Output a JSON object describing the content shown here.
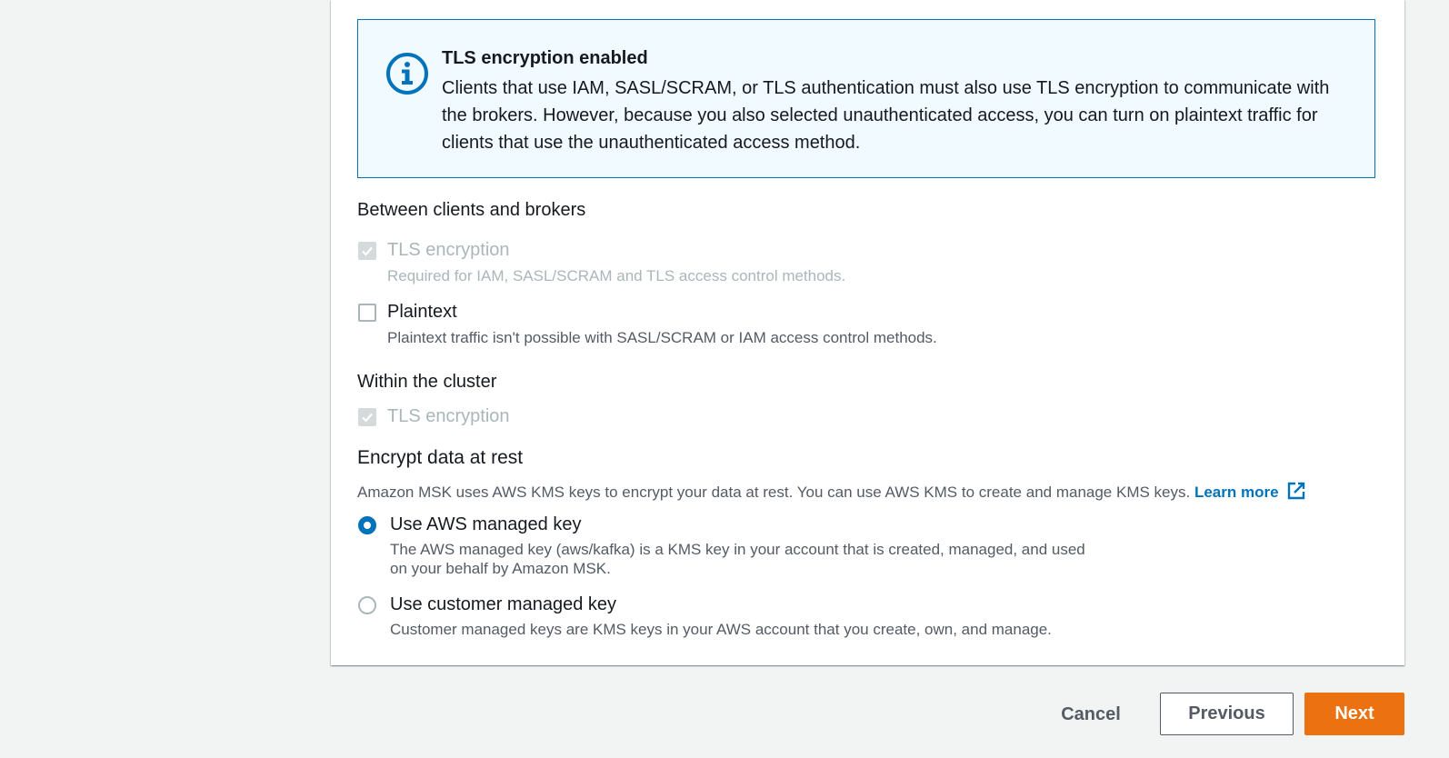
{
  "alert": {
    "title": "TLS encryption enabled",
    "text": "Clients that use IAM, SASL/SCRAM, or TLS authentication must also use TLS encryption to communicate with the brokers. However, because you also selected unauthenticated access, you can turn on plaintext traffic for clients that use the unauthenticated access method.",
    "icon": "info-icon"
  },
  "clients_brokers": {
    "heading": "Between clients and brokers",
    "tls": {
      "label": "TLS encryption",
      "desc": "Required for IAM, SASL/SCRAM and TLS access control methods.",
      "checked": true,
      "disabled": true
    },
    "plaintext": {
      "label": "Plaintext",
      "desc": "Plaintext traffic isn't possible with SASL/SCRAM or IAM access control methods.",
      "checked": false
    }
  },
  "within_cluster": {
    "heading": "Within the cluster",
    "tls": {
      "label": "TLS encryption",
      "checked": true,
      "disabled": true
    }
  },
  "at_rest": {
    "heading": "Encrypt data at rest",
    "desc": "Amazon MSK uses AWS KMS keys to encrypt your data at rest. You can use AWS KMS to create and manage KMS keys.",
    "learn_more": "Learn more",
    "aws_key": {
      "label": "Use AWS managed key",
      "desc_line1": "The AWS managed key (aws/kafka) is a KMS key in your account that is created, managed, and used",
      "desc_line2": "on your behalf by Amazon MSK.",
      "selected": true
    },
    "customer_key": {
      "label": "Use customer managed key",
      "desc": "Customer managed keys are KMS keys in your AWS account that you create, own, and manage.",
      "selected": false
    }
  },
  "footer": {
    "cancel": "Cancel",
    "previous": "Previous",
    "next": "Next"
  },
  "colors": {
    "accent": "#0073bb",
    "primary_button": "#ec7211",
    "alert_bg": "#f1faff"
  }
}
